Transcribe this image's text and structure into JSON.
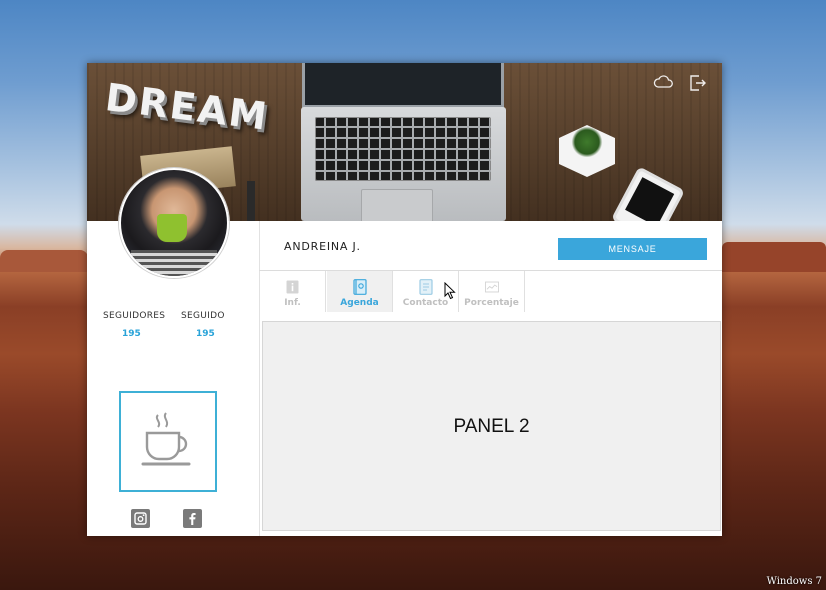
{
  "desktop": {
    "brand": "Windows 7"
  },
  "banner": {
    "decor_text": "DREAM",
    "icons": [
      "cloud-icon",
      "logout-icon"
    ]
  },
  "profile": {
    "name": "ANDREINA J.",
    "message_button": "MENSAJE",
    "stats": [
      {
        "label": "SEGUIDORES",
        "value": "195"
      },
      {
        "label": "SEGUIDO",
        "value": "195"
      }
    ],
    "social": [
      "instagram-icon",
      "facebook-icon"
    ]
  },
  "tabs": [
    {
      "label": "Inf.",
      "icon": "info-icon",
      "active": false
    },
    {
      "label": "Agenda",
      "icon": "agenda-icon",
      "active": true
    },
    {
      "label": "Contacto",
      "icon": "contact-icon",
      "active": false
    },
    {
      "label": "Porcentaje",
      "icon": "chart-icon",
      "active": false
    }
  ],
  "panel": {
    "label": "PANEL 2"
  },
  "colors": {
    "accent": "#3aa6db",
    "tab_active_bg": "#f0f0f0",
    "tab_inactive_text": "#c0c0c0"
  }
}
